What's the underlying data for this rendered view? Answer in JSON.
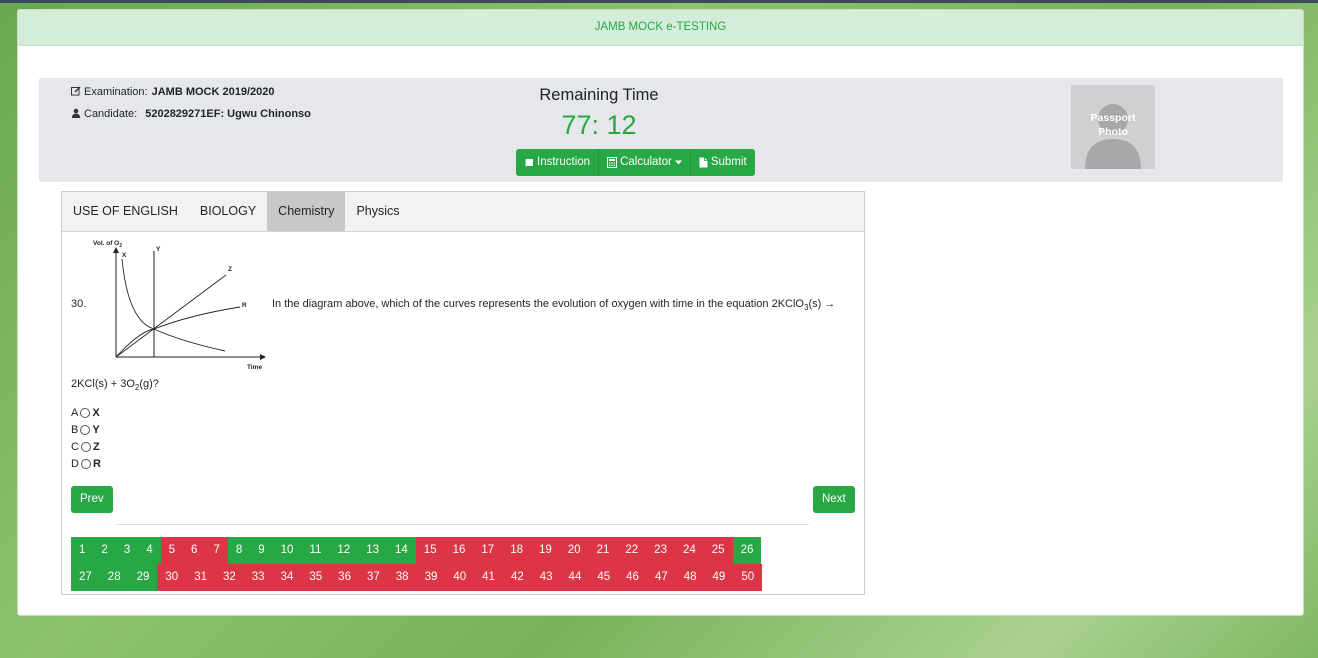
{
  "header": {
    "title": "JAMB MOCK e-TESTING"
  },
  "info": {
    "exam_label": "Examination:",
    "exam_value": "JAMB MOCK 2019/2020",
    "candidate_label": "Candidate:",
    "candidate_value": "5202829271EF: Ugwu Chinonso",
    "remaining_title": "Remaining Time",
    "remaining_value": "77: 12",
    "passport_line1": "Passport",
    "passport_line2": "Photo"
  },
  "actions": {
    "instruction": "Instruction",
    "calculator": "Calculator",
    "submit": "Submit"
  },
  "tabs": [
    "USE OF ENGLISH",
    "BIOLOGY",
    "Chemistry",
    "Physics"
  ],
  "active_tab": "Chemistry",
  "question": {
    "number": "30.",
    "text": "In the diagram above, which of the curves represents the evolution of oxygen with time in the equation 2KClO",
    "text_sub": "3",
    "text_tail": "(s) →",
    "text2_pre": "2KCl(s) + 3O",
    "text2_sub": "2",
    "text2_post": "(g)?",
    "diagram": {
      "y_axis_label": "Vol. of O",
      "y_axis_sub": "2",
      "x_axis_label": "Time",
      "curve_labels": [
        "X",
        "Y",
        "Z",
        "R"
      ]
    },
    "options": [
      {
        "letter": "A",
        "value": "X"
      },
      {
        "letter": "B",
        "value": "Y"
      },
      {
        "letter": "C",
        "value": "Z"
      },
      {
        "letter": "D",
        "value": "R"
      }
    ]
  },
  "nav": {
    "prev": "Prev",
    "next": "Next"
  },
  "question_grid": {
    "numbers": [
      "1",
      "2",
      "3",
      "4",
      "5",
      "6",
      "7",
      "8",
      "9",
      "10",
      "11",
      "12",
      "13",
      "14",
      "15",
      "16",
      "17",
      "18",
      "19",
      "20",
      "21",
      "22",
      "23",
      "24",
      "25",
      "26",
      "27",
      "28",
      "29",
      "30",
      "31",
      "32",
      "33",
      "34",
      "35",
      "36",
      "37",
      "38",
      "39",
      "40",
      "41",
      "42",
      "43",
      "44",
      "45",
      "46",
      "47",
      "48",
      "49",
      "50"
    ],
    "answered": [
      1,
      2,
      3,
      4,
      8,
      9,
      10,
      11,
      12,
      13,
      14,
      26,
      27,
      28,
      29
    ],
    "colors": {
      "answered": "#28a745",
      "unanswered": "#dc3545"
    }
  }
}
